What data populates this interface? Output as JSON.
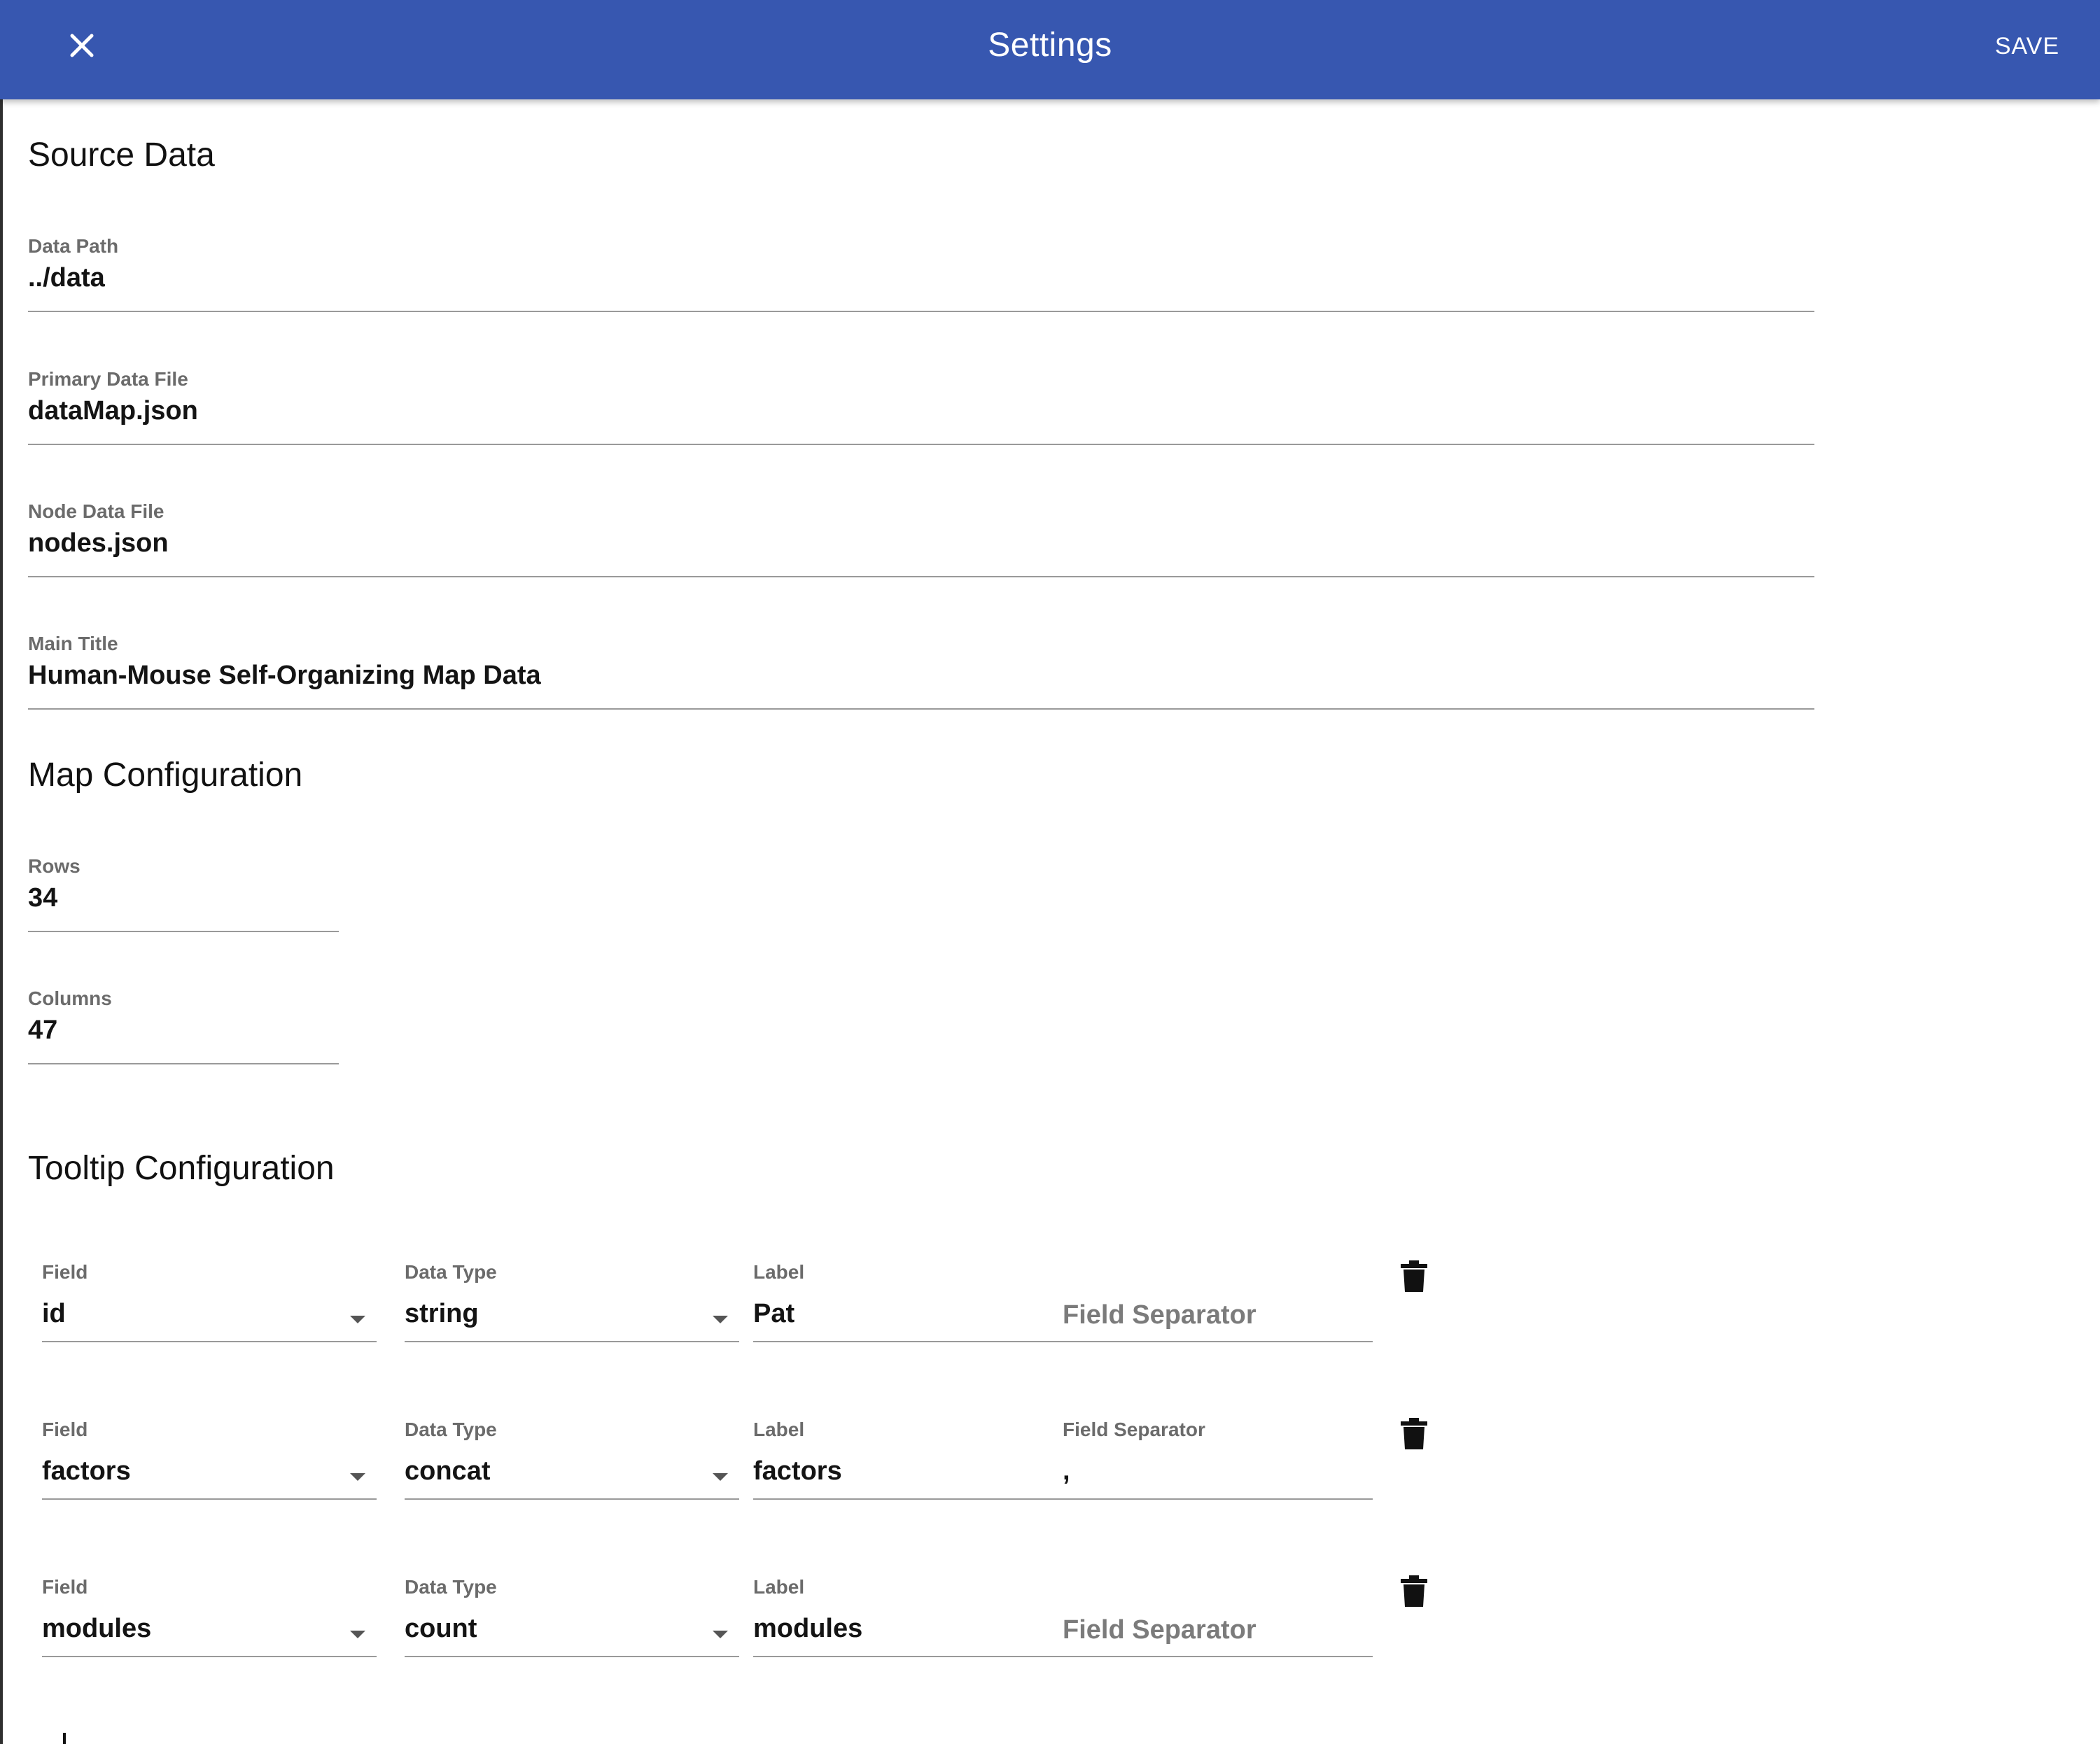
{
  "appbar": {
    "title": "Settings",
    "save_label": "SAVE",
    "close_icon": "close-icon",
    "color": "#3757b0"
  },
  "source_data": {
    "title": "Source Data",
    "data_path": {
      "label": "Data Path",
      "value": "../data"
    },
    "primary_data_file": {
      "label": "Primary Data File",
      "value": "dataMap.json"
    },
    "node_data_file": {
      "label": "Node Data File",
      "value": "nodes.json"
    },
    "main_title": {
      "label": "Main Title",
      "value": "Human-Mouse Self-Organizing Map Data"
    }
  },
  "map_config": {
    "title": "Map Configuration",
    "rows": {
      "label": "Rows",
      "value": "34"
    },
    "columns": {
      "label": "Columns",
      "value": "47"
    }
  },
  "tooltip_config": {
    "title": "Tooltip Configuration",
    "rows": [
      {
        "field_label": "Field",
        "field": "id",
        "type_label": "Data Type",
        "type": "string",
        "label_label": "Label",
        "label": "Pat",
        "separator_label": "Field Separator",
        "separator": ""
      },
      {
        "field_label": "Field",
        "field": "factors",
        "type_label": "Data Type",
        "type": "concat",
        "label_label": "Label",
        "label": "factors",
        "separator_label": "Field Separator",
        "separator": ","
      },
      {
        "field_label": "Field",
        "field": "modules",
        "type_label": "Data Type",
        "type": "count",
        "label_label": "Label",
        "label": "modules",
        "separator_label": "Field Separator",
        "separator": ""
      }
    ],
    "delete_icon": "trash-icon"
  }
}
